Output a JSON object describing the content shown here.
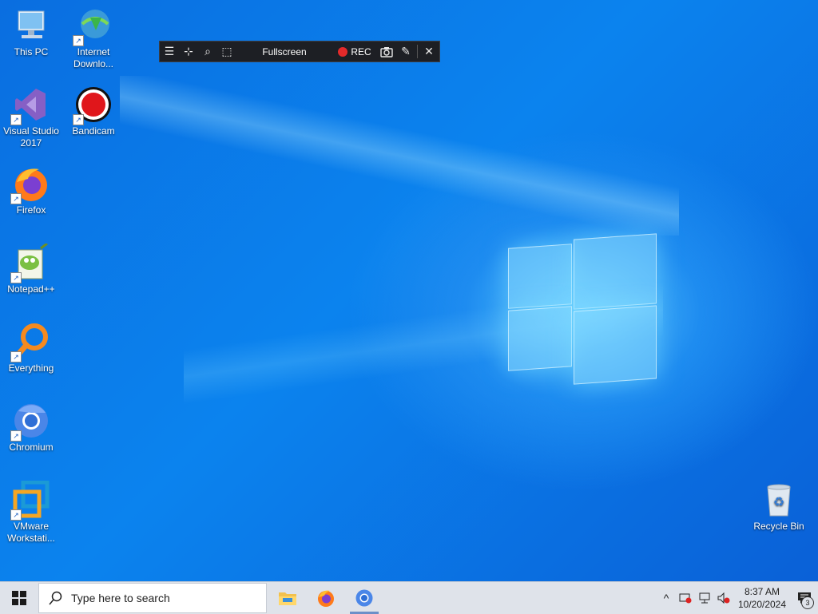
{
  "desktop_icons": [
    {
      "label": "This PC"
    },
    {
      "label": "Internet Downlo..."
    },
    {
      "label": "Visual Studio 2017"
    },
    {
      "label": "Bandicam"
    },
    {
      "label": "Firefox"
    },
    {
      "label": "Notepad++"
    },
    {
      "label": "Everything"
    },
    {
      "label": "Chromium"
    },
    {
      "label": "VMware Workstati..."
    },
    {
      "label": "Recycle Bin"
    }
  ],
  "recorder_toolbar": {
    "mode_label": "Fullscreen",
    "rec_label": "REC"
  },
  "taskbar": {
    "search_placeholder": "Type here to search",
    "time": "8:37 AM",
    "date": "10/20/2024",
    "notification_count": "3"
  },
  "colors": {
    "accent": "#0a78e8",
    "rec_red": "#e32a2a",
    "taskbar_bg": "#dfe3ea"
  }
}
